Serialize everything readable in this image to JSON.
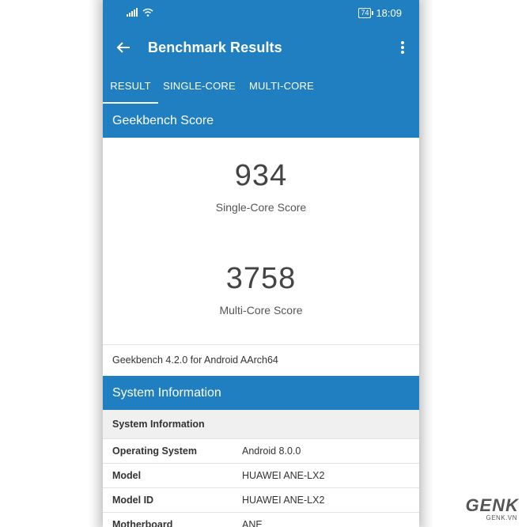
{
  "status_bar": {
    "time": "18:09",
    "battery": "74",
    "icons": [
      "signal-icon",
      "wifi-icon"
    ]
  },
  "toolbar": {
    "title": "Benchmark Results",
    "back_icon": "arrow-left-icon",
    "more_icon": "more-vertical-icon"
  },
  "tabs": [
    {
      "label": "RESULT",
      "active": true
    },
    {
      "label": "SINGLE-CORE",
      "active": false
    },
    {
      "label": "MULTI-CORE",
      "active": false
    }
  ],
  "geekbench_score": {
    "header": "Geekbench Score",
    "single_core": {
      "value": "934",
      "label": "Single-Core Score"
    },
    "multi_core": {
      "value": "3758",
      "label": "Multi-Core Score"
    },
    "version": "Geekbench 4.2.0 for Android AArch64"
  },
  "system_information": {
    "header": "System Information",
    "subheader": "System Information",
    "rows": [
      {
        "key": "Operating System",
        "value": "Android 8.0.0"
      },
      {
        "key": "Model",
        "value": "HUAWEI ANE-LX2"
      },
      {
        "key": "Model ID",
        "value": "HUAWEI ANE-LX2"
      },
      {
        "key": "Motherboard",
        "value": "ANE"
      }
    ]
  },
  "watermark": {
    "main": "GENK",
    "sub": "GENK.VN"
  },
  "colors": {
    "primary": "#1f7fc0",
    "text": "#333333",
    "subheader_bg": "#f0f0f0"
  }
}
